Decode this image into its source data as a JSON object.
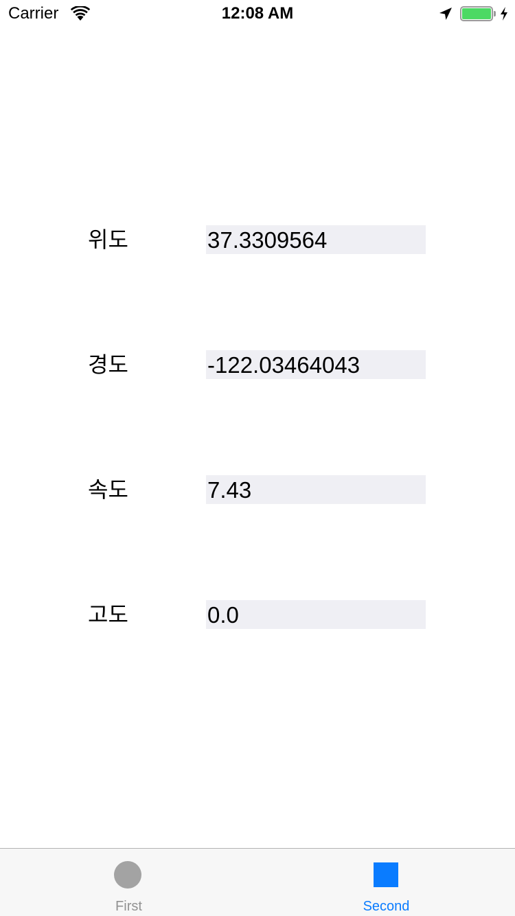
{
  "status_bar": {
    "carrier": "Carrier",
    "time": "12:08 AM",
    "icons": [
      "wifi-icon",
      "location-arrow-icon",
      "battery-icon",
      "charging-bolt-icon"
    ],
    "battery_level": 1.0,
    "battery_color": "#4cd964"
  },
  "rows": [
    {
      "label": "위도",
      "value": "37.3309564"
    },
    {
      "label": "경도",
      "value": "-122.03464043"
    },
    {
      "label": "속도",
      "value": "7.43"
    },
    {
      "label": "고도",
      "value": "0.0"
    }
  ],
  "field_background": "#efeff4",
  "tab_bar": {
    "tabs": [
      {
        "label": "First",
        "icon": "circle-icon",
        "selected": false,
        "color": "#929292"
      },
      {
        "label": "Second",
        "icon": "square-icon",
        "selected": true,
        "color": "#0a7cff"
      }
    ]
  }
}
